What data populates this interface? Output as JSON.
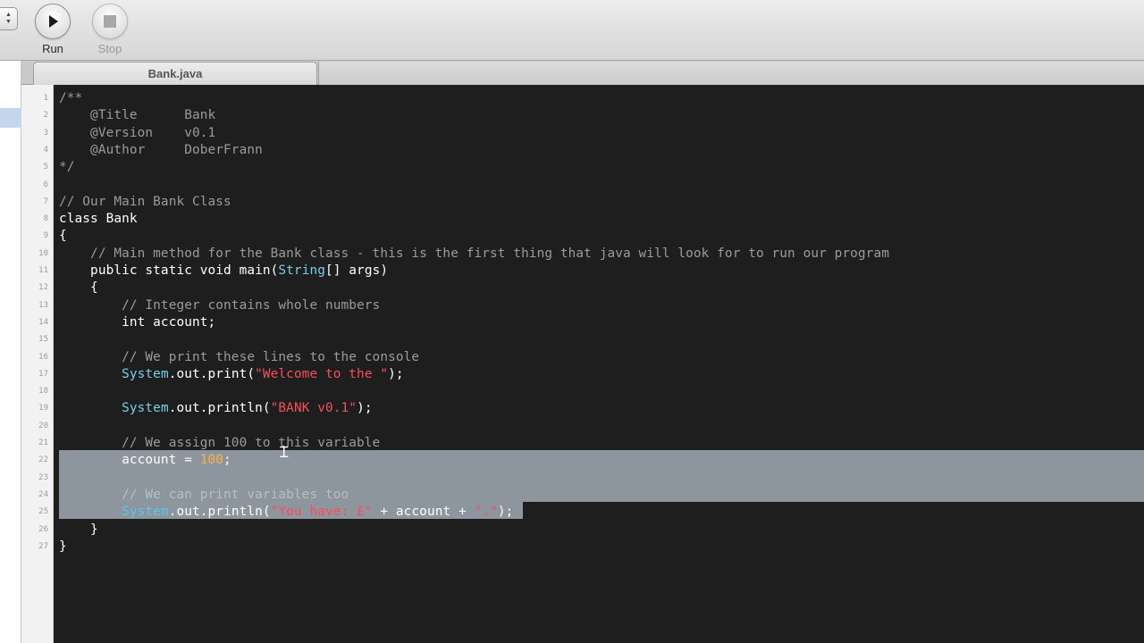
{
  "toolbar": {
    "run_label": "Run",
    "stop_label": "Stop"
  },
  "tab": {
    "filename": "Bank.java"
  },
  "editor": {
    "line_numbers": [
      "1",
      "2",
      "3",
      "4",
      "5",
      "6",
      "7",
      "8",
      "9",
      "10",
      "11",
      "12",
      "13",
      "14",
      "15",
      "16",
      "17",
      "18",
      "19",
      "20",
      "21",
      "22",
      "23",
      "24",
      "25",
      "26",
      "27"
    ],
    "lines": [
      [
        {
          "t": "/**",
          "c": "comment"
        }
      ],
      [
        {
          "t": "    @Title      Bank",
          "c": "comment"
        }
      ],
      [
        {
          "t": "    @Version    v0.1",
          "c": "comment"
        }
      ],
      [
        {
          "t": "    @Author     DoberFrann",
          "c": "comment"
        }
      ],
      [
        {
          "t": "*/",
          "c": "comment"
        }
      ],
      [],
      [
        {
          "t": "// Our Main Bank Class",
          "c": "comment"
        }
      ],
      [
        {
          "t": "class",
          "c": "kw"
        },
        {
          "t": " Bank",
          "c": "plain"
        }
      ],
      [
        {
          "t": "{",
          "c": "plain"
        }
      ],
      [
        {
          "t": "    // Main method for the Bank class - this is the first thing that java will look for to run our program",
          "c": "comment"
        }
      ],
      [
        {
          "t": "    public static void ",
          "c": "kw"
        },
        {
          "t": "main(",
          "c": "plain"
        },
        {
          "t": "String",
          "c": "cls"
        },
        {
          "t": "[] args)",
          "c": "plain"
        }
      ],
      [
        {
          "t": "    {",
          "c": "plain"
        }
      ],
      [
        {
          "t": "        // Integer contains whole numbers",
          "c": "comment"
        }
      ],
      [
        {
          "t": "        int ",
          "c": "kw"
        },
        {
          "t": "account;",
          "c": "plain"
        }
      ],
      [],
      [
        {
          "t": "        // We print these lines to the console",
          "c": "comment"
        }
      ],
      [
        {
          "t": "        ",
          "c": "plain"
        },
        {
          "t": "System",
          "c": "cls"
        },
        {
          "t": ".out.print(",
          "c": "plain"
        },
        {
          "t": "\"Welcome to the \"",
          "c": "str"
        },
        {
          "t": ");",
          "c": "plain"
        }
      ],
      [],
      [
        {
          "t": "        ",
          "c": "plain"
        },
        {
          "t": "System",
          "c": "cls"
        },
        {
          "t": ".out.println(",
          "c": "plain"
        },
        {
          "t": "\"BANK v0.1\"",
          "c": "str"
        },
        {
          "t": ");",
          "c": "plain"
        }
      ],
      [],
      [
        {
          "t": "        // We assign 100 to this variable",
          "c": "comment"
        }
      ],
      [
        {
          "t": "        account = ",
          "c": "plain"
        },
        {
          "t": "100",
          "c": "num"
        },
        {
          "t": ";",
          "c": "plain"
        }
      ],
      [],
      [
        {
          "t": "        // We can print variables too",
          "c": "comment"
        }
      ],
      [
        {
          "t": "        ",
          "c": "plain"
        },
        {
          "t": "System",
          "c": "cls"
        },
        {
          "t": ".out.println(",
          "c": "plain"
        },
        {
          "t": "\"You have: £\"",
          "c": "str"
        },
        {
          "t": " + account + ",
          "c": "plain"
        },
        {
          "t": "\".\"",
          "c": "str"
        },
        {
          "t": ");",
          "c": "plain"
        }
      ],
      [
        {
          "t": "    }",
          "c": "plain"
        }
      ],
      [
        {
          "t": "}",
          "c": "plain"
        }
      ]
    ]
  },
  "colors": {
    "editor_bg": "#1e1e1e",
    "selection": "#8d969f",
    "comment": "#9b9b9b",
    "class": "#74d0e9",
    "string": "#f3505c",
    "number": "#ffb23a"
  }
}
